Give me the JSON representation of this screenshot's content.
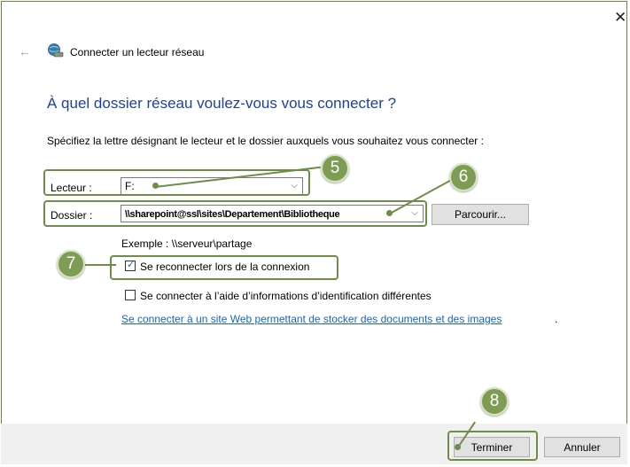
{
  "window": {
    "title": "Connecter un lecteur réseau",
    "close_glyph": "✕",
    "back_glyph": "←"
  },
  "heading": "À quel dossier réseau voulez-vous vous connecter ?",
  "instruction": "Spécifiez la lettre désignant le lecteur et le dossier auxquels vous souhaitez vous connecter :",
  "drive": {
    "label": "Lecteur :",
    "value": "F:"
  },
  "folder": {
    "label": "Dossier :",
    "value": "\\\\sharepoint@ssl\\sites\\Departement\\Bibliotheque"
  },
  "browse_label": "Parcourir...",
  "example": "Exemple : \\\\serveur\\partage",
  "reconnect": {
    "label": "Se reconnecter lors de la connexion",
    "checked": true
  },
  "other_credentials": {
    "label": "Se connecter à l’aide d’informations d’identification différentes",
    "checked": false
  },
  "website_link": "Se connecter à un site Web permettant de stocker des documents et des images",
  "link_period": ".",
  "finish_label": "Terminer",
  "cancel_label": "Annuler",
  "callouts": [
    "5",
    "6",
    "7",
    "8"
  ],
  "chevron_glyph": "⌵",
  "colors": {
    "annotation": "#6e8e48",
    "heading": "#1f3fa3",
    "link": "#1565c0"
  }
}
